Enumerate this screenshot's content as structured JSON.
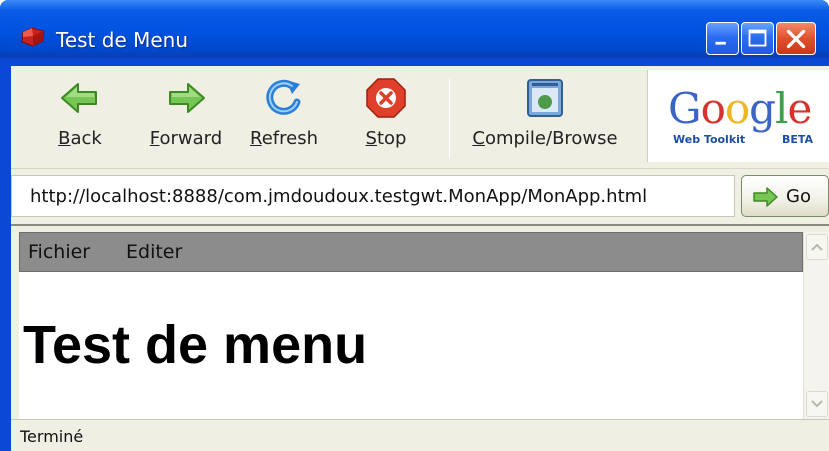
{
  "window": {
    "title": "Test de Menu"
  },
  "toolbar": {
    "back_label": "Back",
    "back_accel": "B",
    "back_rest": "ack",
    "forward_label": "Forward",
    "forward_accel": "F",
    "forward_rest": "orward",
    "refresh_label": "Refresh",
    "refresh_accel": "R",
    "refresh_rest": "efresh",
    "stop_label": "Stop",
    "stop_accel": "S",
    "stop_rest": "top",
    "compile_label": "Compile/Browse",
    "compile_accel": "C",
    "compile_rest": "ompile/Browse",
    "logo": {
      "word": "Google",
      "sub": "Web Toolkit",
      "beta": "BETA"
    }
  },
  "urlbar": {
    "url": "http://localhost:8888/com.jmdoudoux.testgwt.MonApp/MonApp.html",
    "go_label": "Go"
  },
  "page": {
    "menu": [
      "Fichier",
      "Editer"
    ],
    "title": "Test de menu"
  },
  "status": {
    "text": "Terminé"
  },
  "colors": {
    "titlebar": "#0052e0",
    "chrome": "#f0efe3",
    "menubar": "#8c8c8c",
    "arrow_green": "#5fb23c",
    "stop_red": "#e0402a",
    "refresh_blue": "#2c7fd8"
  },
  "icons": {
    "app": "red-gem-icon",
    "back": "green-left-arrow-icon",
    "forward": "green-right-arrow-icon",
    "refresh": "blue-refresh-icon",
    "stop": "red-stop-icon",
    "compile": "browser-window-icon",
    "go": "green-right-arrow-icon"
  }
}
